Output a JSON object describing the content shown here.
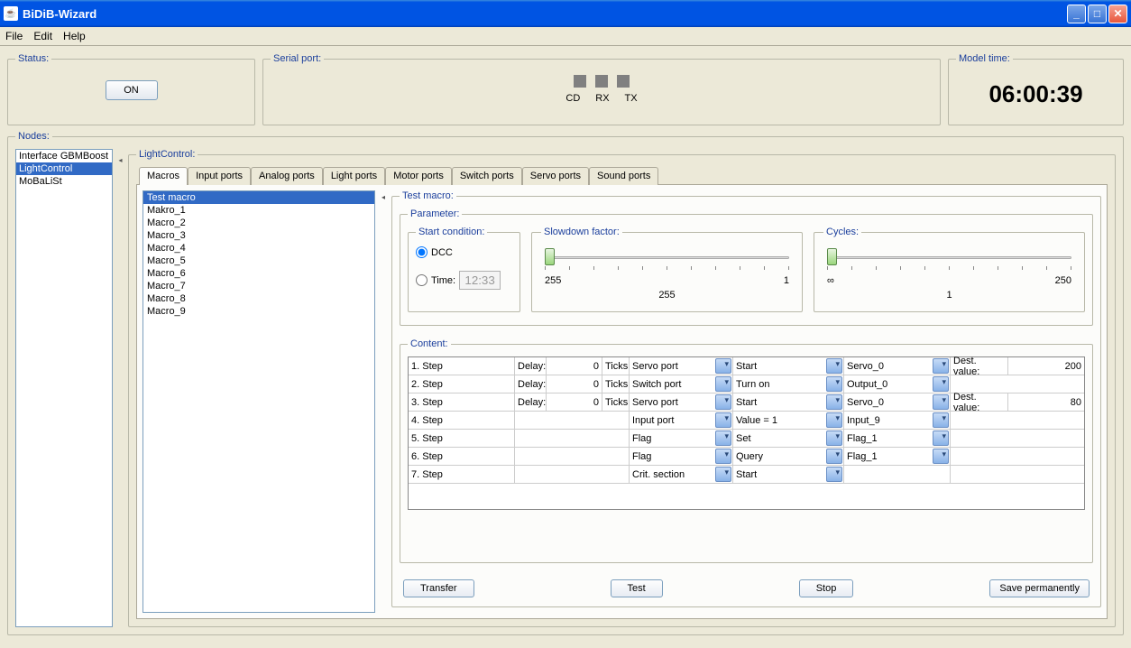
{
  "window": {
    "title": "BiDiB-Wizard"
  },
  "menu": {
    "file": "File",
    "edit": "Edit",
    "help": "Help"
  },
  "status": {
    "legend": "Status:",
    "button": "ON"
  },
  "serial": {
    "legend": "Serial port:",
    "cd": "CD",
    "rx": "RX",
    "tx": "TX"
  },
  "clock": {
    "legend": "Model time:",
    "value": "06:00:39"
  },
  "nodes": {
    "legend": "Nodes:",
    "items": [
      "Interface GBMBoost",
      "LightControl",
      "MoBaLiSt"
    ],
    "selected": 1
  },
  "lightcontrol": {
    "legend": "LightControl:",
    "tabs": [
      "Macros",
      "Input ports",
      "Analog ports",
      "Light ports",
      "Motor ports",
      "Switch ports",
      "Servo ports",
      "Sound ports"
    ],
    "macros": [
      "Test macro",
      "Makro_1",
      "Macro_2",
      "Macro_3",
      "Macro_4",
      "Macro_5",
      "Macro_6",
      "Macro_7",
      "Macro_8",
      "Macro_9"
    ],
    "macro_selected": 0,
    "detail": {
      "legend": "Test macro:",
      "parameter": {
        "legend": "Parameter:",
        "start": {
          "legend": "Start condition:",
          "dcc": "DCC",
          "time": "Time:",
          "time_val": "12:33"
        },
        "slowdown": {
          "legend": "Slowdown factor:",
          "min": "255",
          "max": "1",
          "center": "255"
        },
        "cycles": {
          "legend": "Cycles:",
          "min": "∞",
          "max": "250",
          "center": "1"
        }
      },
      "content": {
        "legend": "Content:",
        "labels": {
          "step": "Step",
          "delay": "Delay:",
          "ticks": "Ticks",
          "dest": "Dest. value:"
        },
        "rows": [
          {
            "n": "1.",
            "delay": "0",
            "ticks": true,
            "type": "Servo port",
            "action": "Start",
            "target": "Servo_0",
            "dest_lbl": true,
            "dest": "200"
          },
          {
            "n": "2.",
            "delay": "0",
            "ticks": true,
            "type": "Switch port",
            "action": "Turn on",
            "target": "Output_0"
          },
          {
            "n": "3.",
            "delay": "0",
            "ticks": true,
            "type": "Servo port",
            "action": "Start",
            "target": "Servo_0",
            "dest_lbl": true,
            "dest": "80"
          },
          {
            "n": "4.",
            "type": "Input port",
            "action": "Value = 1",
            "target": "Input_9"
          },
          {
            "n": "5.",
            "type": "Flag",
            "action": "Set",
            "target": "Flag_1"
          },
          {
            "n": "6.",
            "type": "Flag",
            "action": "Query",
            "target": "Flag_1"
          },
          {
            "n": "7.",
            "type": "Crit. section",
            "action": "Start",
            "no_target": true
          }
        ]
      },
      "buttons": {
        "transfer": "Transfer",
        "test": "Test",
        "stop": "Stop",
        "save": "Save permanently"
      }
    }
  }
}
